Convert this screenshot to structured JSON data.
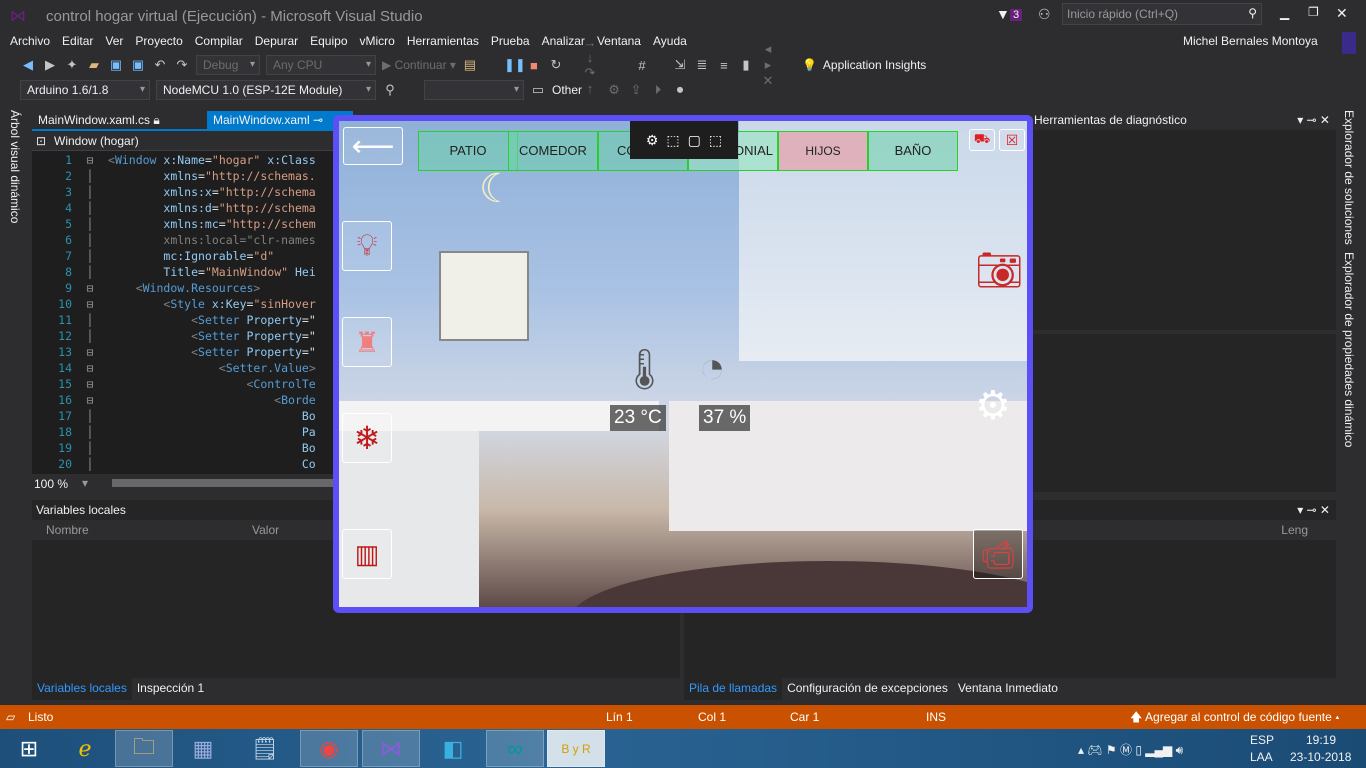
{
  "window": {
    "title": "control hogar virtual (Ejecución) - Microsoft Visual Studio",
    "notif_count": "3",
    "quick_launch_placeholder": "Inicio rápido (Ctrl+Q)",
    "user": "Michel Bernales Montoya"
  },
  "menu": [
    "Archivo",
    "Editar",
    "Ver",
    "Proyecto",
    "Compilar",
    "Depurar",
    "Equipo",
    "vMicro",
    "Herramientas",
    "Prueba",
    "Analizar",
    "Ventana",
    "Ayuda"
  ],
  "toolbar": {
    "config": "Debug",
    "platform": "Any CPU",
    "continue": "Continuar",
    "insights": "Application Insights",
    "arduino": "Arduino 1.6/1.8",
    "board": "NodeMCU 1.0 (ESP-12E Module)",
    "other": "Other"
  },
  "tabs": [
    {
      "label": "MainWindow.xaml.cs"
    },
    {
      "label": "MainWindow.xaml",
      "active": true
    }
  ],
  "editor": {
    "breadcrumb": "Window (hogar)",
    "zoom": "100 %",
    "lines": [
      [
        [
          "p",
          "<"
        ],
        [
          "t",
          "Window"
        ],
        [
          "a",
          " x:Name"
        ],
        [
          "x",
          "="
        ],
        [
          "sv",
          "\"hogar\""
        ],
        [
          "a",
          " x:Class"
        ]
      ],
      [
        [
          "x",
          "        "
        ],
        [
          "a",
          "xmlns"
        ],
        [
          "x",
          "="
        ],
        [
          "sv",
          "\"http://schemas."
        ]
      ],
      [
        [
          "x",
          "        "
        ],
        [
          "a",
          "xmlns:x"
        ],
        [
          "x",
          "="
        ],
        [
          "sv",
          "\"http://schema"
        ]
      ],
      [
        [
          "x",
          "        "
        ],
        [
          "a",
          "xmlns:d"
        ],
        [
          "x",
          "="
        ],
        [
          "sv",
          "\"http://schema"
        ]
      ],
      [
        [
          "x",
          "        "
        ],
        [
          "a",
          "xmlns:mc"
        ],
        [
          "x",
          "="
        ],
        [
          "sv",
          "\"http://schem"
        ]
      ],
      [
        [
          "x",
          "        "
        ],
        [
          "p",
          "xmlns:local=\"clr-names"
        ]
      ],
      [
        [
          "x",
          "        "
        ],
        [
          "a",
          "mc:Ignorable"
        ],
        [
          "x",
          "="
        ],
        [
          "sv",
          "\"d\""
        ]
      ],
      [
        [
          "x",
          "        "
        ],
        [
          "a",
          "Title"
        ],
        [
          "x",
          "="
        ],
        [
          "sv",
          "\"MainWindow\""
        ],
        [
          "a",
          " Hei"
        ]
      ],
      [
        [
          "x",
          "    "
        ],
        [
          "p",
          "<"
        ],
        [
          "t",
          "Window.Resources"
        ],
        [
          "p",
          ">"
        ]
      ],
      [
        [
          "x",
          "        "
        ],
        [
          "p",
          "<"
        ],
        [
          "t",
          "Style"
        ],
        [
          "a",
          " x:Key"
        ],
        [
          "x",
          "="
        ],
        [
          "sv",
          "\"sinHover"
        ]
      ],
      [
        [
          "x",
          "            "
        ],
        [
          "p",
          "<"
        ],
        [
          "t",
          "Setter"
        ],
        [
          "a",
          " Property"
        ],
        [
          "x",
          "=\""
        ]
      ],
      [
        [
          "x",
          "            "
        ],
        [
          "p",
          "<"
        ],
        [
          "t",
          "Setter"
        ],
        [
          "a",
          " Property"
        ],
        [
          "x",
          "=\""
        ]
      ],
      [
        [
          "x",
          "            "
        ],
        [
          "p",
          "<"
        ],
        [
          "t",
          "Setter"
        ],
        [
          "a",
          " Property"
        ],
        [
          "x",
          "=\""
        ]
      ],
      [
        [
          "x",
          "                "
        ],
        [
          "p",
          "<"
        ],
        [
          "t",
          "Setter.Value"
        ],
        [
          "p",
          ">"
        ]
      ],
      [
        [
          "x",
          "                    "
        ],
        [
          "p",
          "<"
        ],
        [
          "t",
          "ControlTe"
        ]
      ],
      [
        [
          "x",
          "                        "
        ],
        [
          "p",
          "<"
        ],
        [
          "t",
          "Borde"
        ]
      ],
      [
        [
          "x",
          "                            "
        ],
        [
          "a",
          "Bo"
        ]
      ],
      [
        [
          "x",
          "                            "
        ],
        [
          "a",
          "Pa"
        ]
      ],
      [
        [
          "x",
          "                            "
        ],
        [
          "a",
          "Bo"
        ]
      ],
      [
        [
          "x",
          "                            "
        ],
        [
          "a",
          "Co"
        ]
      ]
    ],
    "folds": [
      1,
      9,
      10,
      13,
      14,
      15,
      16
    ]
  },
  "side": {
    "left_vertical": "Árbol visual dinámico",
    "right_vertical_1": "Explorador de soluciones",
    "right_vertical_2": "Explorador de propiedades dinámico",
    "diag": "Herramientas de diagnóstico"
  },
  "app": {
    "tabs": [
      "PATIO",
      "COMEDOR",
      "CO",
      "MONIAL",
      "HIJOS",
      "BAÑO"
    ],
    "temperature": "23 °C",
    "humidity": "37 %",
    "accent": "#5b4ff5"
  },
  "locals": {
    "title": "Variables locales",
    "col_name": "Nombre",
    "col_value": "Valor",
    "tabs": [
      "Variables locales",
      "Inspección 1"
    ]
  },
  "callstack": {
    "col_lang": "Leng",
    "tabs": [
      "Pila de llamadas",
      "Configuración de excepciones",
      "Ventana Inmediato"
    ]
  },
  "status": {
    "ready": "Listo",
    "line": "Lín 1",
    "col": "Col 1",
    "char": "Car 1",
    "mode": "INS",
    "source_control": "Agregar al control de código fuente"
  },
  "taskbar": {
    "lang": "ESP",
    "layout": "LAA",
    "time": "19:19",
    "date": "23-10-2018"
  }
}
